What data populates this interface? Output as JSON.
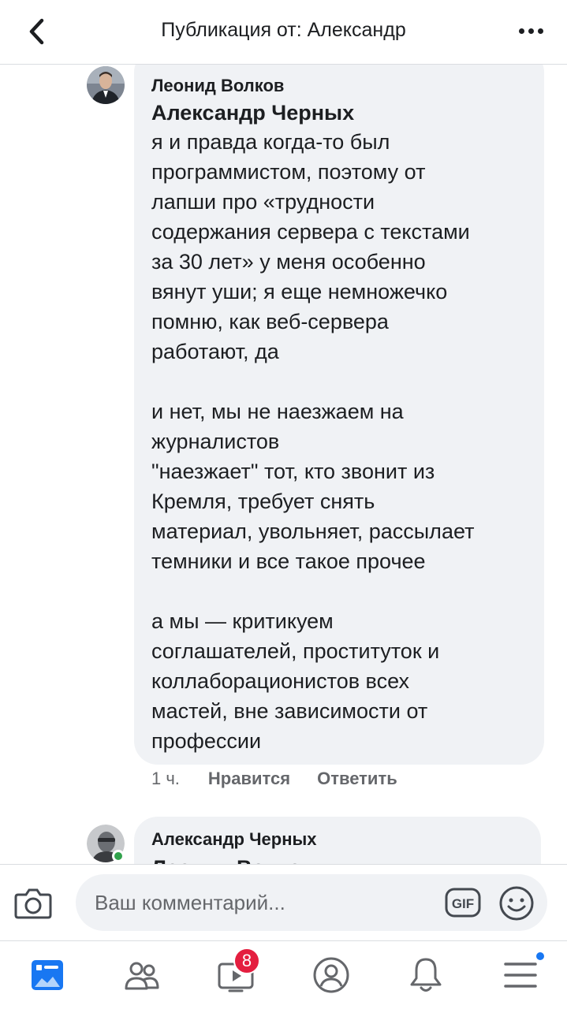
{
  "header": {
    "title": "Публикация от: Александр",
    "back_icon": "chevron-left-icon",
    "more_icon": "more-dots-icon"
  },
  "comments": [
    {
      "author": "Леонид Волков",
      "mention": "Александр Черных",
      "text": "я и правда когда-то был\nпрограммистом, поэтому от\nлапши про «трудности\nсодержания сервера с текстами\nза 30 лет» у меня особенно\nвянут уши; я еще немножечко\nпомню, как веб-сервера\nработают, да\n\nи нет, мы не наезжаем на\nжурналистов\n\"наезжает\" тот, кто звонит из\nКремля, требует снять\nматериал, увольняет, рассылает\nтемники и все такое прочее\n\nа мы — критикуем\nсоглашателей, проституток и\nколлаборационистов всех\nмастей, вне зависимости от\nпрофессии",
      "time": "1 ч.",
      "like_label": "Нравится",
      "reply_label": "Ответить"
    },
    {
      "author": "Александр Черных",
      "mention": "Леонид Волков",
      "online": true
    }
  ],
  "composer": {
    "placeholder": "Ваш комментарий...",
    "gif_label": "GIF"
  },
  "tabbar": {
    "items": [
      "news-feed-icon",
      "groups-icon",
      "watch-icon",
      "profile-icon",
      "notifications-icon",
      "menu-icon"
    ],
    "watch_badge": "8"
  },
  "colors": {
    "active_tab": "#1877f2",
    "badge": "#e41e3f",
    "online": "#31a24c",
    "bubble": "#f0f2f5"
  }
}
